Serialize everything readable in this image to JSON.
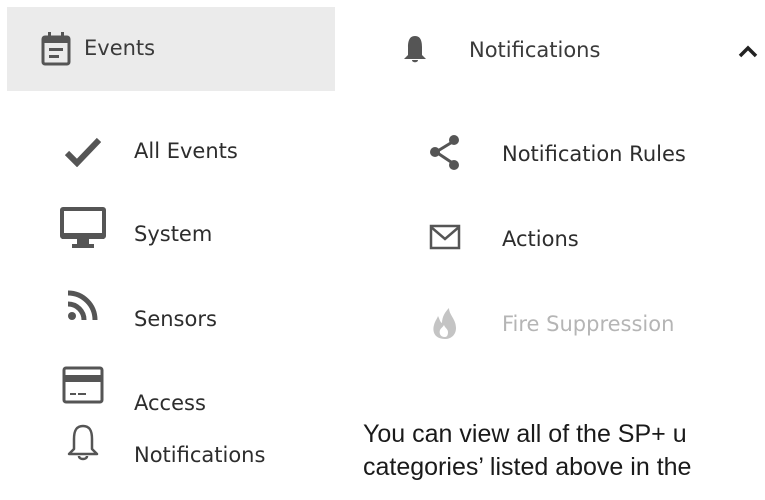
{
  "left_menu": {
    "header": {
      "label": "Events",
      "icon": "event-note-icon"
    },
    "items": [
      {
        "label": "All Events",
        "icon": "checkmark-icon"
      },
      {
        "label": "System",
        "icon": "desktop-monitor-icon"
      },
      {
        "label": "Sensors",
        "icon": "rss-feed-icon"
      },
      {
        "label": "Access",
        "icon": "credit-card-icon"
      },
      {
        "label": "Notifications",
        "icon": "bell-outline-icon"
      }
    ]
  },
  "right_menu": {
    "header": {
      "label": "Notifications",
      "icon": "bell-filled-icon",
      "expand_icon": "chevron-up-icon"
    },
    "items": [
      {
        "label": "Notification Rules",
        "icon": "share-icon",
        "disabled": false
      },
      {
        "label": "Actions",
        "icon": "envelope-icon",
        "disabled": false
      },
      {
        "label": "Fire Suppression",
        "icon": "flame-icon",
        "disabled": true
      }
    ]
  },
  "paragraph": {
    "line1": "You can view all of the SP+ u",
    "line2": "categories’ listed above in the"
  },
  "colors": {
    "header_bg": "#ebebeb",
    "icon": "#555555",
    "disabled": "#b5b5b5"
  }
}
